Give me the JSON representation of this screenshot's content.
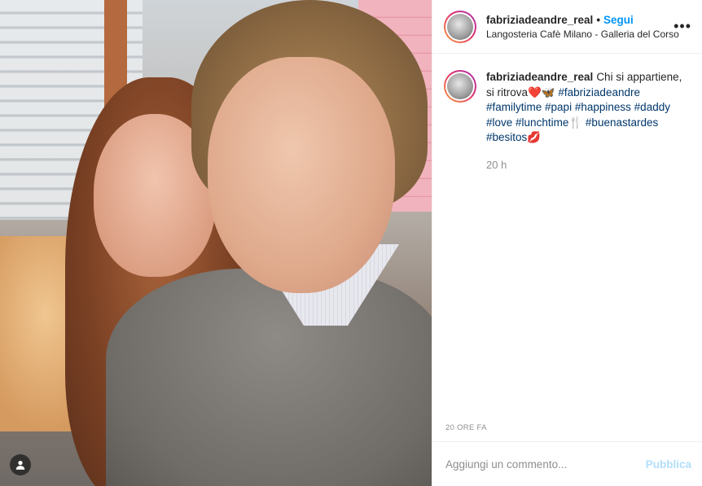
{
  "post": {
    "username": "fabriziadeandre_real",
    "follow_label": "Segui",
    "location": "Langosteria Cafè Milano - Galleria del Corso",
    "separator": "•"
  },
  "caption": {
    "username": "fabriziadeandre_real",
    "text_before": "Chi si appartiene, si ritrova",
    "emoji_heart": "❤️",
    "emoji_butterfly": "🦋",
    "hashtags": [
      "#fabriziadeandre",
      "#familytime",
      "#papi",
      "#happiness",
      "#daddy",
      "#love",
      "#lunchtime",
      "#buenastardes",
      "#besitos"
    ],
    "emoji_after_lunchtime": "🍴",
    "emoji_end": "💋",
    "relative_time": "20 h"
  },
  "meta": {
    "posted_ago": "20 ORE FA"
  },
  "comment": {
    "placeholder": "Aggiungi un commento...",
    "publish_label": "Pubblica"
  },
  "icons": {
    "more": "more-options-icon",
    "user_tag": "user-tag-icon"
  },
  "colors": {
    "link_blue": "#0095f6",
    "hashtag": "#00376b",
    "muted": "#8e8e8e",
    "publish_disabled": "#b2dffc"
  }
}
